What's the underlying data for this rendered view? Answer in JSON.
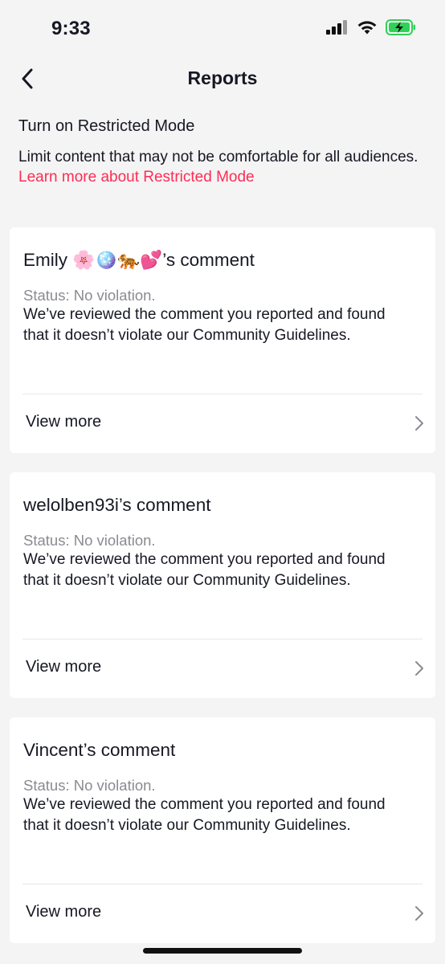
{
  "status_bar": {
    "time": "9:33",
    "icons": [
      "signal-icon",
      "wifi-icon",
      "battery-charging-icon"
    ],
    "battery_color": "#30d158"
  },
  "nav": {
    "title": "Reports",
    "back_icon": "chevron-left-icon"
  },
  "restricted_mode": {
    "title": "Turn on Restricted Mode",
    "description": "Limit content that may not be comfortable for all audiences.",
    "link_label": "Learn more about Restricted Mode",
    "link_color": "#fe2c55"
  },
  "reports": [
    {
      "title": "Emily 🌸🪩🐅💕’s comment",
      "status": "Status: No violation.",
      "body": "We’ve reviewed the comment you reported and found that it doesn’t violate our Community Guidelines.",
      "action": "View more"
    },
    {
      "title": "welolben93i’s comment",
      "status": "Status: No violation.",
      "body": "We’ve reviewed the comment you reported and found that it doesn’t violate our Community Guidelines.",
      "action": "View more"
    },
    {
      "title": "Vincent’s comment",
      "status": "Status: No violation.",
      "body": "We’ve reviewed the comment you reported and found that it doesn’t violate our Community Guidelines.",
      "action": "View more"
    }
  ]
}
